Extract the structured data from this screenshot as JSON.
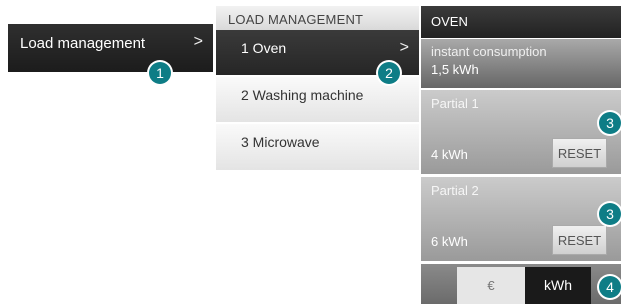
{
  "menu1": {
    "label": "Load management"
  },
  "panel2": {
    "title": "LOAD MANAGEMENT",
    "items": [
      {
        "label": "1 Oven"
      },
      {
        "label": "2 Washing machine"
      },
      {
        "label": "3 Microwave"
      }
    ]
  },
  "panel3": {
    "title": "OVEN",
    "instant": {
      "label": "instant consumption",
      "value": "1,5 kWh"
    },
    "partials": [
      {
        "label": "Partial 1",
        "value": "4 kWh",
        "reset_label": "RESET"
      },
      {
        "label": "Partial 2",
        "value": "6 kWh",
        "reset_label": "RESET"
      }
    ],
    "units": {
      "euro": "€",
      "kwh": "kWh",
      "selected": "kWh"
    }
  },
  "badges": [
    "1",
    "2",
    "3",
    "3",
    "4"
  ],
  "colors": {
    "badge": "#0e7d86",
    "selected_dark": "#1a1a1a"
  },
  "icons": {
    "chevron": "chevron-right-icon"
  }
}
